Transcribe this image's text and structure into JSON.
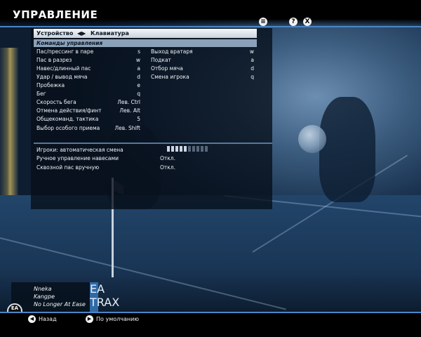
{
  "header": {
    "title": "УПРАВЛЕНИЕ",
    "buttons": [
      {
        "name": "menu",
        "glyph": "≡"
      },
      {
        "name": "help",
        "glyph": "?"
      },
      {
        "name": "close",
        "glyph": "X"
      }
    ]
  },
  "device": {
    "label": "Устройство",
    "arrows": "◀▶",
    "value": "Клавиатура"
  },
  "section": {
    "title": "Команды управления"
  },
  "controls_left": [
    {
      "label": "Пас/прессинг в паре",
      "key": "s"
    },
    {
      "label": "Пас в разрез",
      "key": "w"
    },
    {
      "label": "Навес/длинный пас",
      "key": "a"
    },
    {
      "label": "Удар / вывод мяча",
      "key": "d"
    },
    {
      "label": "Пробежка",
      "key": "e"
    },
    {
      "label": "Бег",
      "key": "q"
    },
    {
      "label": "Скорость бега",
      "key": "Лев. Ctrl"
    },
    {
      "label": "Отмена действия/финт",
      "key": "Лев. Alt"
    },
    {
      "label": "Общекоманд. тактика",
      "key": "5"
    },
    {
      "label": "Выбор особого приема",
      "key": "Лев. Shift"
    }
  ],
  "controls_right": [
    {
      "label": "Выход вратаря",
      "key": "w"
    },
    {
      "label": "Подкат",
      "key": "a"
    },
    {
      "label": "Отбор мяча",
      "key": "d"
    },
    {
      "label": "Смена игрока",
      "key": "q"
    }
  ],
  "settings": [
    {
      "label": "Игроки: автоматическая смена",
      "value": "",
      "level": 0.5
    },
    {
      "label": "Ручное управление навесами",
      "value": "Откл."
    },
    {
      "label": "Сквозной пас вручную",
      "value": "Откл."
    }
  ],
  "music": {
    "track": "Nneka",
    "artist": "Kangpe",
    "album": "No Longer At Ease",
    "tag": "EA TRAX"
  },
  "logo": {
    "text": "EA"
  },
  "footer": {
    "back": "Назад",
    "defaults": "По умолчанию"
  }
}
